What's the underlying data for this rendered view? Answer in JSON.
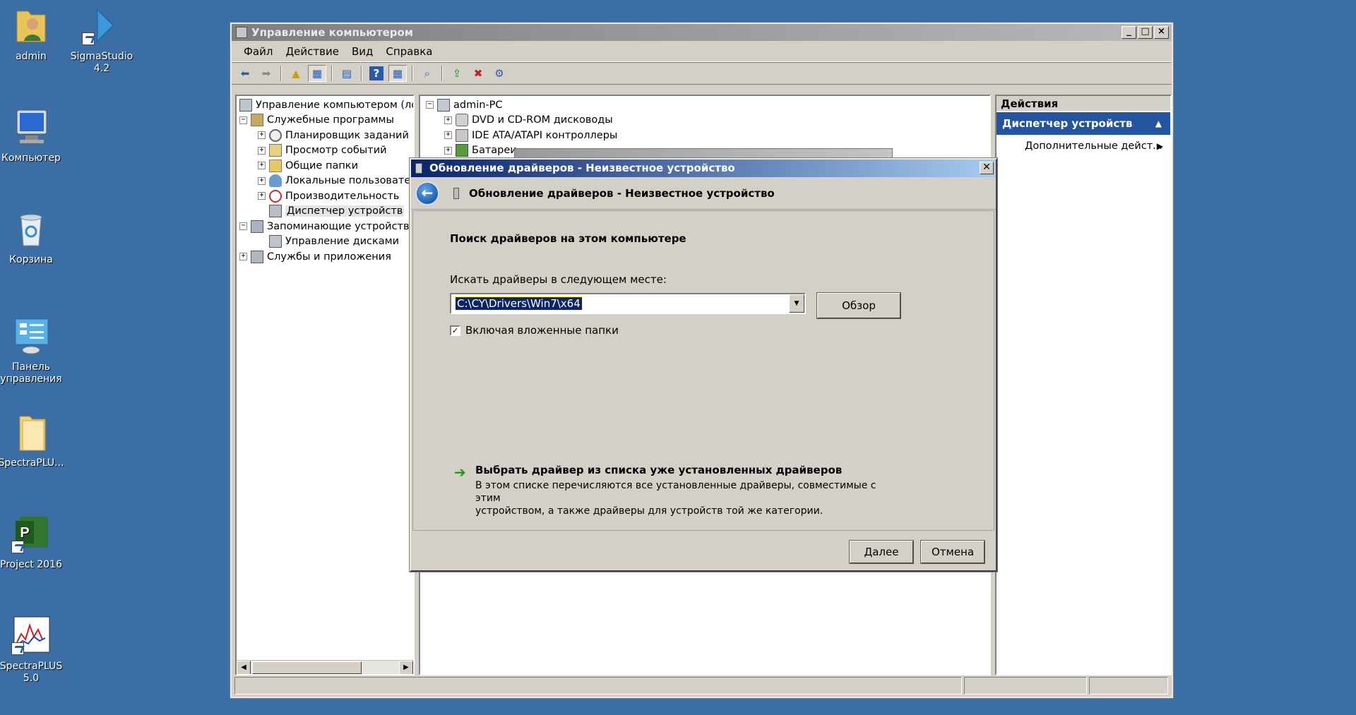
{
  "desktop": {
    "icons": [
      {
        "label": "admin",
        "icon": "user-folder-icon"
      },
      {
        "label": "SigmaStudio 4.2",
        "icon": "sigmastudio-icon"
      },
      {
        "label": "Компьютер",
        "icon": "computer-icon"
      },
      {
        "label": "Корзина",
        "icon": "recycle-bin-icon"
      },
      {
        "label": "Панель управления",
        "icon": "control-panel-icon"
      },
      {
        "label": "SpectraPLU...",
        "icon": "folder-icon"
      },
      {
        "label": "Project 2016",
        "icon": "project-icon"
      },
      {
        "label": "SpectraPLUS 5.0",
        "icon": "spectraplus-icon"
      }
    ]
  },
  "mmc": {
    "title": "Управление компьютером",
    "menu": [
      "Файл",
      "Действие",
      "Вид",
      "Справка"
    ],
    "tree": [
      {
        "label": "Управление компьютером (лока",
        "expander": "",
        "indent": 0
      },
      {
        "label": "Служебные программы",
        "expander": "−",
        "indent": 1
      },
      {
        "label": "Планировщик заданий",
        "expander": "+",
        "indent": 2
      },
      {
        "label": "Просмотр событий",
        "expander": "+",
        "indent": 2
      },
      {
        "label": "Общие папки",
        "expander": "+",
        "indent": 2
      },
      {
        "label": "Локальные пользовате",
        "expander": "+",
        "indent": 2
      },
      {
        "label": "Производительность",
        "expander": "+",
        "indent": 2
      },
      {
        "label": "Диспетчер устройств",
        "expander": "",
        "indent": 2,
        "selected": true
      },
      {
        "label": "Запоминающие устройства",
        "expander": "−",
        "indent": 1
      },
      {
        "label": "Управление дисками",
        "expander": "",
        "indent": 2
      },
      {
        "label": "Службы и приложения",
        "expander": "+",
        "indent": 1
      }
    ],
    "devices": [
      {
        "label": "admin-PC",
        "expander": "−",
        "indent": 0
      },
      {
        "label": "DVD и CD-ROM дисководы",
        "expander": "+",
        "indent": 1
      },
      {
        "label": "IDE ATA/ATAPI контроллеры",
        "expander": "+",
        "indent": 1
      },
      {
        "label": "Батареи",
        "expander": "+",
        "indent": 1
      }
    ],
    "actions": {
      "header": "Действия",
      "section": "Диспетчер устройств",
      "item": "Дополнительные дейст..."
    }
  },
  "dialog": {
    "title": "Обновление драйверов - Неизвестное устройство",
    "wizard_title": "Обновление драйверов - Неизвестное устройство",
    "section_title": "Поиск драйверов на этом компьютере",
    "path_label": "Искать драйверы в следующем месте:",
    "path_value": "C:\\CY\\Drivers\\Win7\\x64",
    "browse": "Обзор",
    "include_subfolders": "Включая вложенные папки",
    "include_subfolders_checked": true,
    "pick_title": "Выбрать драйвер из списка уже установленных драйверов",
    "pick_desc_1": "В этом списке перечисляются все установленные драйверы, совместимые с этим",
    "pick_desc_2": "устройством, а также драйверы для устройств той же категории.",
    "next": "Далее",
    "cancel": "Отмена"
  },
  "colors": {
    "desktop": "#3a6ea5",
    "dialog_title": "#0a246a",
    "actions_section": "#2354a0"
  }
}
